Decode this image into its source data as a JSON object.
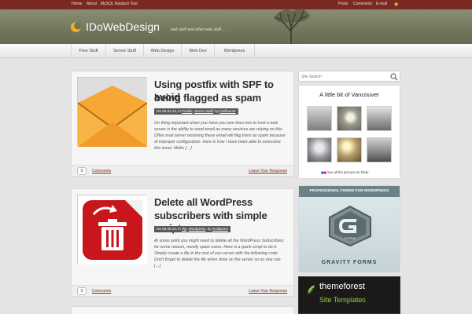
{
  "topnav": {
    "left": [
      "Home",
      "About",
      "MySQL Replace Tool"
    ],
    "right": [
      "Posts",
      "Comments",
      "E-mail"
    ]
  },
  "header": {
    "title": "IDoWebDesign",
    "tagline": "web stuff and other web stuff ..."
  },
  "nav": [
    "Free Stuff",
    "Server Stuff",
    "Web Design",
    "Web Dev",
    "Wordpress"
  ],
  "posts": [
    {
      "title_line1": "Using postfix with SPF to avoid",
      "title_line2": "being flagged as spam",
      "meta_prefix": "On 05.31.14, in ",
      "cat1": "Postfix",
      "cat2": "Server Stuff",
      "by": ", by ",
      "author": "Guillaume",
      "excerpt": "On thing important when you have you own linux box to host a web server is the ability to send email as many services are relying on this. Often mail server receiving these email will flag them as spam because of improper configuration. Here is how I have been able to overcome this issue: Make […]",
      "comment_count": "0",
      "comments_label": "Comments",
      "leave_label": "Leave Your Response"
    },
    {
      "title_line1": "Delete all WordPress",
      "title_line2": "subscribers with simple script",
      "meta_prefix": "On 06.06.13, in ",
      "cat1": "Tip",
      "cat2": "Wordpress",
      "by": ", by ",
      "author": "Guillaume",
      "excerpt": "At some point you might need to delete all the WordPress Subscribers for some reason, mostly spam users. Here is a quick script to do it. Simply create a file in the root of you server with the following code: Don't forget to delete the file when done on the server so no one can […]",
      "comment_count": "0",
      "comments_label": "Comments",
      "leave_label": "Leave Your Response"
    }
  ],
  "sidebar": {
    "search_placeholder": "Site Search",
    "flickr_title": "A little bit of Vancouver",
    "flickr_link": "See all the pictures on Flickr",
    "ad_heading": "PROFESSIONAL FORMS FOR WORDPRESS",
    "ad_name": "GRAVITY FORMS",
    "tf_name": "themeforest",
    "tf_sub": "Site Templates"
  },
  "colors": {
    "accent": "#7a2a20",
    "header": "#6f7359",
    "link": "#7a2a20"
  }
}
